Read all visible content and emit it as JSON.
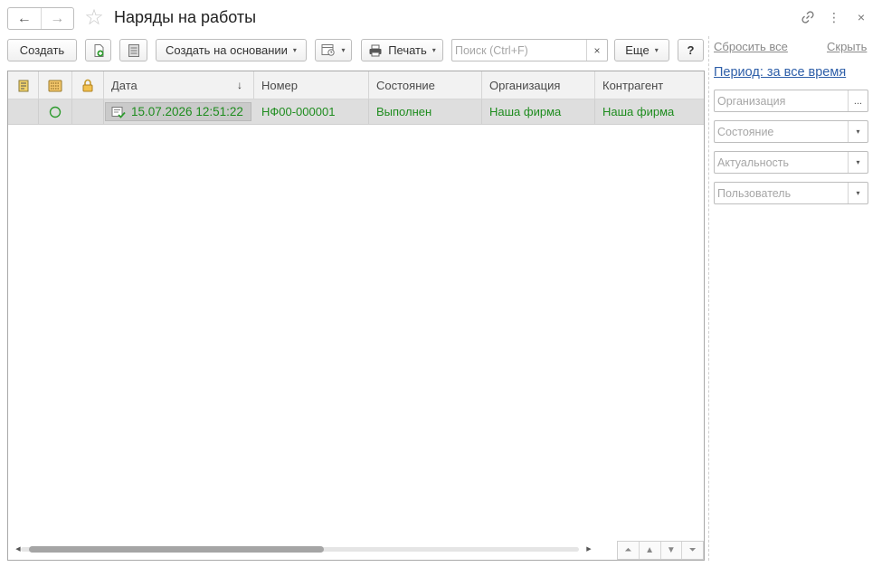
{
  "window": {
    "title": "Наряды на работы",
    "nav_back_icon": "←",
    "nav_forward_icon": "→",
    "favorite_icon": "☆",
    "link_icon": "🔗",
    "more_icon": "⋮",
    "close_icon": "×"
  },
  "toolbar": {
    "create_label": "Создать",
    "create_based_on_label": "Создать на основании",
    "print_label": "Печать",
    "more_label": "Еще",
    "help_label": "?",
    "search_placeholder": "Поиск (Ctrl+F)",
    "search_clear": "×",
    "dropdown_caret": "▾"
  },
  "table": {
    "columns": [
      "",
      "",
      "",
      "Дата",
      "Номер",
      "Состояние",
      "Организация",
      "Контрагент"
    ],
    "sort_indicator": "↓",
    "rows": [
      {
        "date": "15.07.2026 12:51:22",
        "number": "НФ00-000001",
        "status": "Выполнен",
        "organization": "Наша фирма",
        "counterparty": "Наша фирма"
      }
    ],
    "text_color": "#1e8c1e",
    "selected_row_color": "#dedede",
    "horizontal_scroll_fraction_visible": 0.53
  },
  "filters": {
    "reset_all": "Сбросить все",
    "hide": "Скрыть",
    "period": "Период: за все время",
    "organization_placeholder": "Организация",
    "organization_button": "...",
    "state_placeholder": "Состояние",
    "relevance_placeholder": "Актуальность",
    "user_placeholder": "Пользователь",
    "link_color": "#2d5ea8"
  }
}
